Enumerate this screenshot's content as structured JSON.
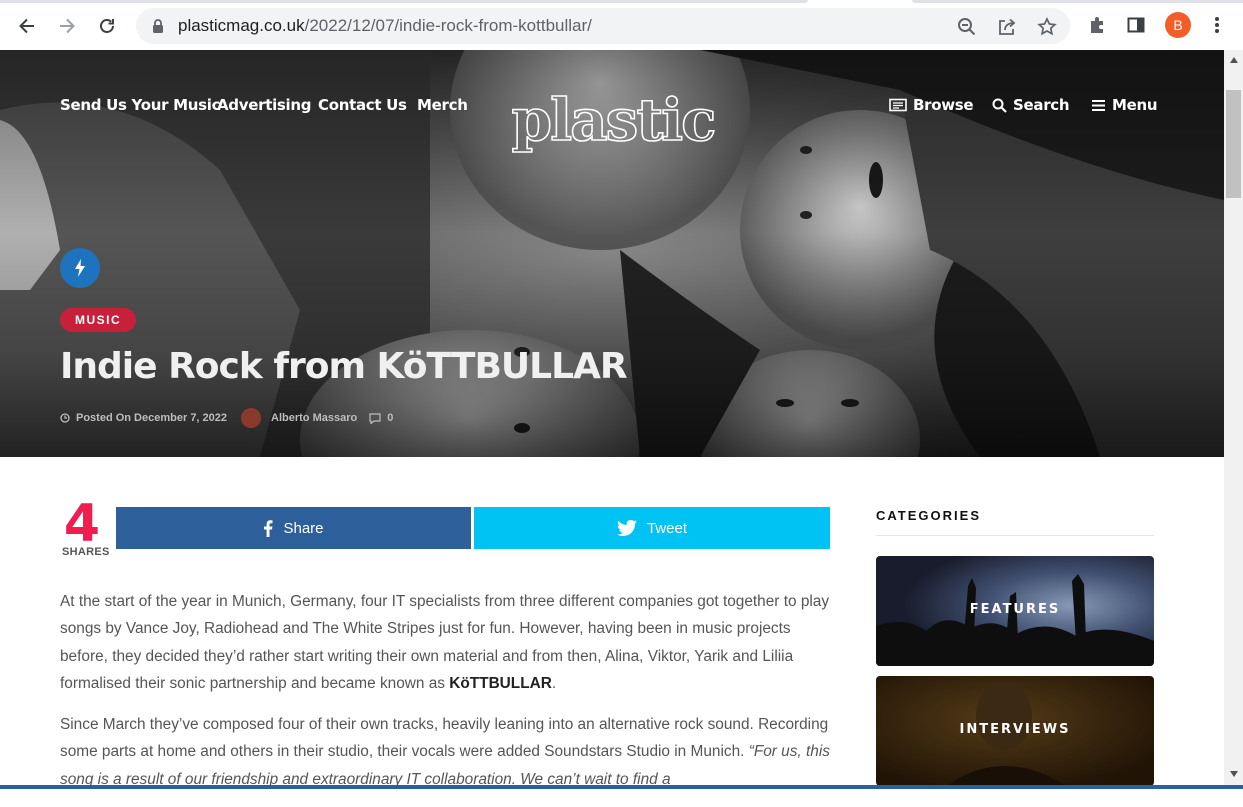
{
  "browser": {
    "url_domain": "plasticmag.co.uk",
    "url_path": "/2022/12/07/indie-rock-from-kottbullar/",
    "profile_initial": "B"
  },
  "site": {
    "logo_text": "plastic",
    "nav_left": [
      "Send Us Your Music",
      "Advertising",
      "Contact Us",
      "Merch"
    ],
    "nav_right": {
      "browse": "Browse",
      "search": "Search",
      "menu": "Menu"
    }
  },
  "post": {
    "category": "MUSIC",
    "title": "Indie Rock from KöTTBULLAR",
    "posted_on": "Posted On December 7, 2022",
    "author": "Alberto Massaro",
    "comments": "0"
  },
  "share": {
    "count": "4",
    "count_label": "SHARES",
    "facebook_label": "Share",
    "twitter_label": "Tweet",
    "facebook_color": "#2d5f9a",
    "twitter_color": "#00c3f3"
  },
  "article": {
    "p1_text": "At the start of the year in Munich, Germany, four IT specialists from three different companies got together to play songs by Vance Joy, Radiohead and The White Stripes just for fun. However, having been in music projects before, they decided they’d rather start writing their own material and from then, Alina, Viktor, Yarik and Liliia formalised their sonic partnership and became known as ",
    "p1_band": "KöTTBULLAR",
    "p1_end": ".",
    "p2_text": "Since March they’ve composed four of their own tracks, heavily leaning into an alternative rock sound. Recording some parts at home and others in their studio, their vocals were added Soundstars Studio in Munich. ",
    "p2_quote": "“For us, this song is a result of our friendship and extraordinary IT collaboration. We can’t wait to find a"
  },
  "sidebar": {
    "heading": "CATEGORIES",
    "tiles": [
      "FEATURES",
      "INTERVIEWS"
    ]
  }
}
